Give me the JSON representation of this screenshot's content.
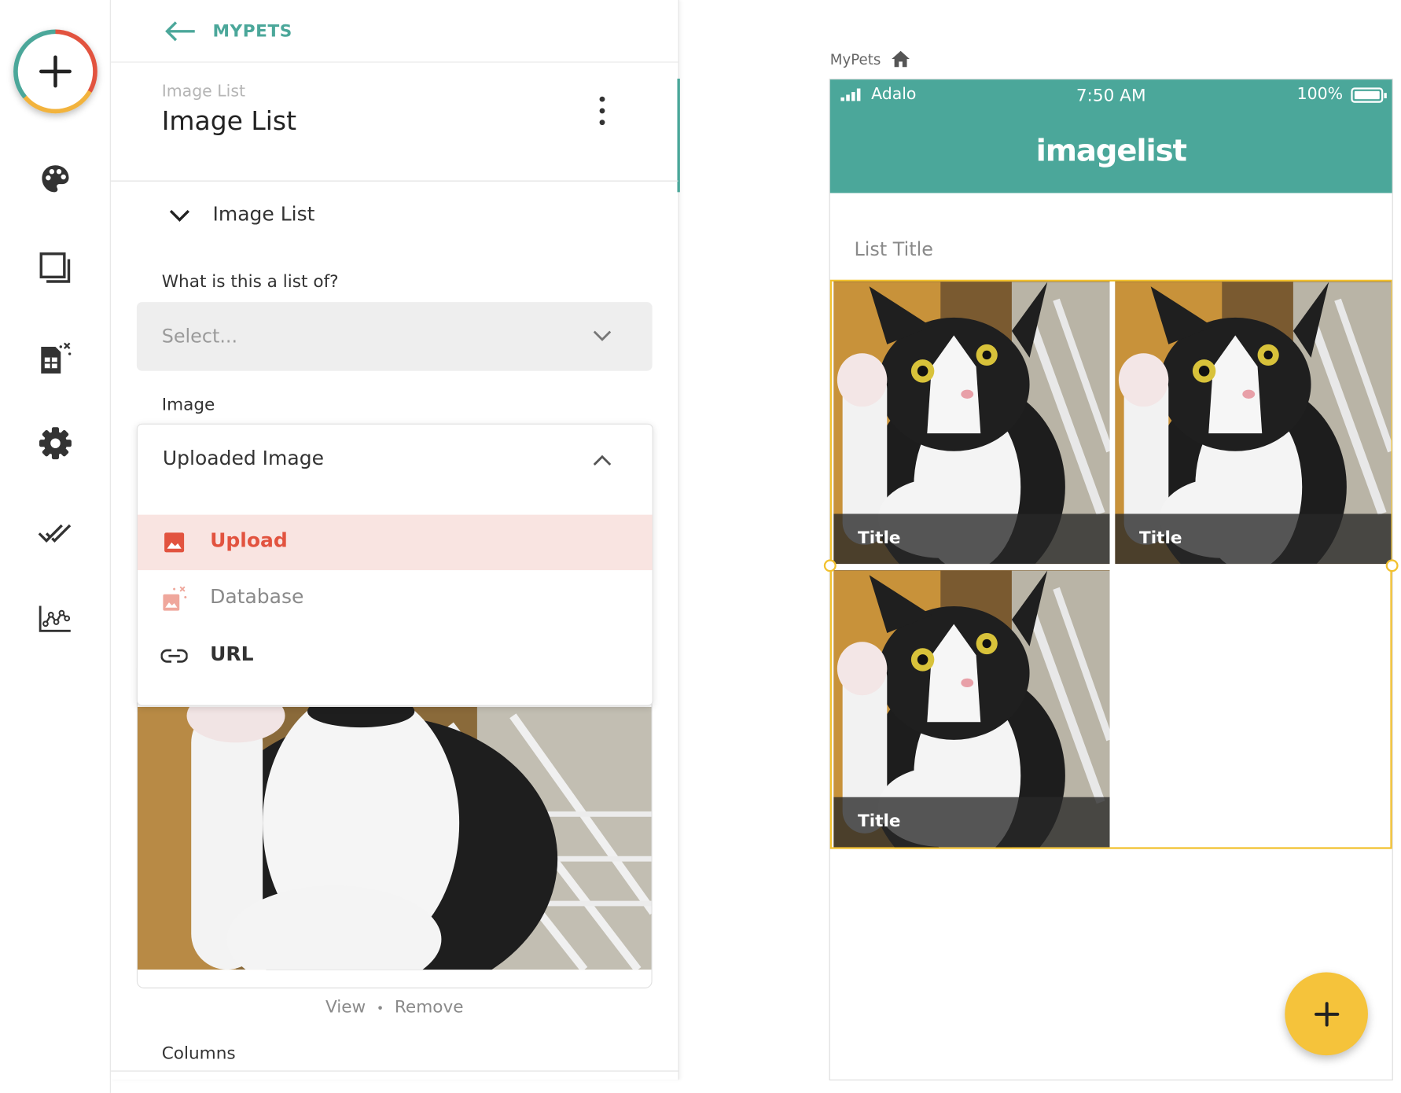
{
  "nav": {
    "back_label": "MYPETS"
  },
  "component": {
    "subtitle": "Image List",
    "title": "Image List",
    "section_label": "Image List"
  },
  "form": {
    "list_of_label": "What is this a list of?",
    "list_of_placeholder": "Select...",
    "image_label": "Image",
    "image_source_value": "Uploaded Image",
    "image_source_options": [
      {
        "label": "Upload",
        "icon": "image-icon",
        "selected": true
      },
      {
        "label": "Database",
        "icon": "database-image-icon",
        "selected": false
      },
      {
        "label": "URL",
        "icon": "link-icon",
        "selected": false
      }
    ],
    "view_label": "View",
    "separator": "•",
    "remove_label": "Remove",
    "columns_label": "Columns"
  },
  "preview": {
    "breadcrumb": "MyPets",
    "status": {
      "carrier": "Adalo",
      "time": "7:50 AM",
      "battery": "100%"
    },
    "app_title": "imagelist",
    "list_title": "List Title",
    "tiles": [
      {
        "title": "Title"
      },
      {
        "title": "Title"
      },
      {
        "title": "Title"
      }
    ]
  },
  "colors": {
    "accent_teal": "#4ba79a",
    "accent_red": "#e2533f",
    "accent_yellow": "#f5c33b",
    "selection": "#f2c12e"
  }
}
